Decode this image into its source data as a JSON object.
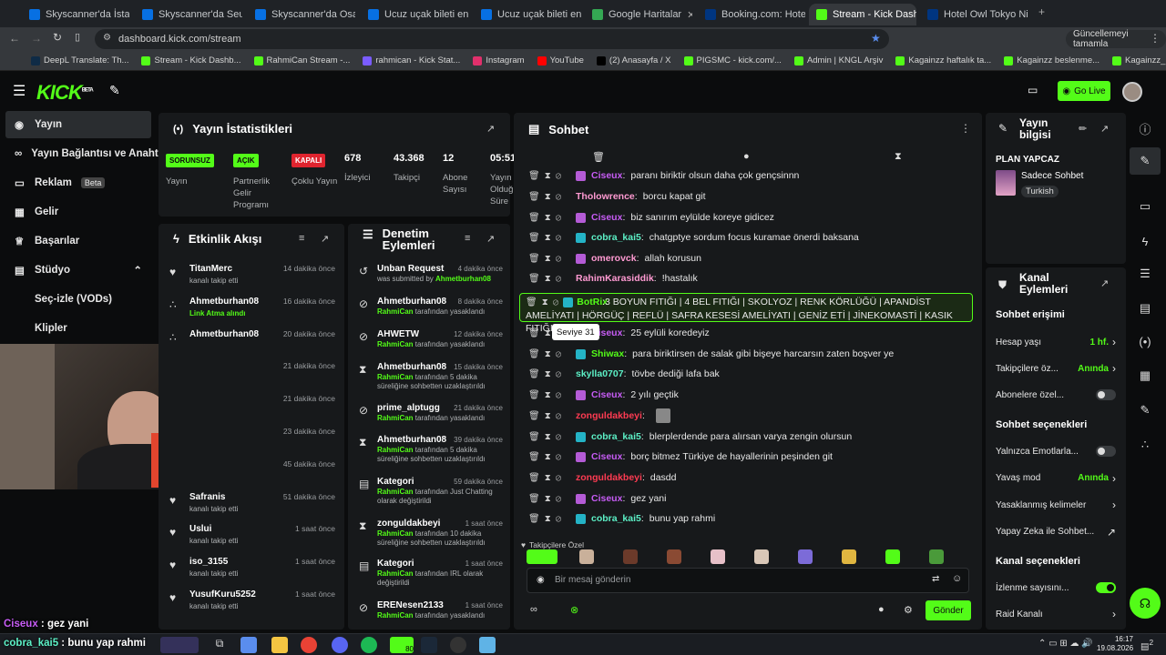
{
  "tabs": [
    {
      "label": "Skyscanner'da İstanb",
      "color": "#0770e3"
    },
    {
      "label": "Skyscanner'da Seul-T",
      "color": "#0770e3"
    },
    {
      "label": "Skyscanner'da Osaka",
      "color": "#0770e3"
    },
    {
      "label": "Ucuz uçak bileti en u",
      "color": "#0770e3"
    },
    {
      "label": "Ucuz uçak bileti en u",
      "color": "#0770e3"
    },
    {
      "label": "Google Haritalar",
      "color": "#34a853"
    },
    {
      "label": "Booking.com: Hotels",
      "color": "#003580"
    },
    {
      "label": "Stream - Kick Dashb",
      "color": "#53fc18"
    },
    {
      "label": "Hotel Owl Tokyo Nip",
      "color": "#003580"
    }
  ],
  "browser": {
    "url": "dashboard.kick.com/stream",
    "update_label": "Güncellemeyi tamamla"
  },
  "bookmarks": [
    "DeepL Translate: Th...",
    "Stream - Kick Dashb...",
    "RahmiCan Stream -...",
    "rahmican - Kick Stat...",
    "Instagram",
    "YouTube",
    "(2) Anasayfa / X",
    "PIGSMC - kick.com/...",
    "Admin | KNGL Arşiv",
    "Kagainzz haftalık ta...",
    "Kagainzz beslenme...",
    "Kagainzz_PPLXUL -..."
  ],
  "header": {
    "logo": "KICK",
    "logo_sup": "BETA",
    "go_live": "Go Live"
  },
  "sidebar": [
    {
      "label": "Yayın",
      "icon": "play-icon"
    },
    {
      "label": "Yayın Bağlantısı ve Anahtarı",
      "icon": "link-icon"
    },
    {
      "label": "Reklam",
      "badge": "Beta",
      "icon": "ad-icon"
    },
    {
      "label": "Gelir",
      "icon": "revenue-icon"
    },
    {
      "label": "Başarılar",
      "icon": "trophy-icon"
    },
    {
      "label": "Stüdyo",
      "icon": "studio-icon"
    },
    {
      "label": "Seç-izle (VODs)",
      "icon": ""
    },
    {
      "label": "Klipler",
      "icon": ""
    }
  ],
  "stats": {
    "title": "Yayın İstatistikleri",
    "items": [
      {
        "pill": "SORUNSUZ",
        "pill_color": "#53fc18",
        "label": "Yayın"
      },
      {
        "pill": "AÇIK",
        "pill_color": "#53fc18",
        "label": "Partnerlik Gelir Programı"
      },
      {
        "pill": "KAPALI",
        "pill_color": "#e0242f",
        "label": "Çoklu Yayın"
      },
      {
        "value": "678",
        "label": "İzleyici"
      },
      {
        "value": "43.368",
        "label": "Takipçi"
      },
      {
        "value": "12",
        "label": "Abone Sayısı"
      },
      {
        "value": "05:51",
        "label": "Yayın Olduğu Süre"
      }
    ]
  },
  "activity": {
    "title": "Etkinlik Akışı",
    "items": [
      {
        "name": "TitanMerc",
        "sub": "kanalı takip etti",
        "time": "14 dakika önce",
        "icon": "heart-icon"
      },
      {
        "name": "Ahmetburhan08",
        "sub": "Link Atma alındı",
        "time": "16 dakika önce",
        "icon": "points-icon"
      },
      {
        "name": "Ahmetburhan08",
        "sub": "",
        "time": "20 dakika önce",
        "icon": "points-icon"
      },
      {
        "name": "",
        "sub": "",
        "time": "21 dakika önce",
        "icon": ""
      },
      {
        "name": "",
        "sub": "",
        "time": "21 dakika önce",
        "icon": ""
      },
      {
        "name": "",
        "sub": "",
        "time": "23 dakika önce",
        "icon": ""
      },
      {
        "name": "",
        "sub": "",
        "time": "45 dakika önce",
        "icon": ""
      },
      {
        "name": "Safranis",
        "sub": "kanalı takip etti",
        "time": "51 dakika önce",
        "icon": "heart-icon"
      },
      {
        "name": "Uslui",
        "sub": "kanalı takip etti",
        "time": "1 saat önce",
        "icon": "heart-icon"
      },
      {
        "name": "iso_3155",
        "sub": "kanalı takip etti",
        "time": "1 saat önce",
        "icon": "heart-icon"
      },
      {
        "name": "YusufKuru5252",
        "sub": "kanalı takip etti",
        "time": "1 saat önce",
        "icon": "heart-icon"
      }
    ]
  },
  "moderation": {
    "title": "Denetim Eylemleri",
    "items": [
      {
        "name": "Unban Request",
        "sub_pre": "was submitted by ",
        "sub_hl": "Ahmetburhan08",
        "sub_post": "",
        "time": "4 dakika önce",
        "icon": "history-icon"
      },
      {
        "name": "Ahmetburhan08",
        "sub_pre": "",
        "sub_hl": "RahmiCan",
        "sub_post": " tarafından yasaklandı",
        "time": "8 dakika önce",
        "icon": "ban-icon"
      },
      {
        "name": "AHWETW",
        "sub_pre": "",
        "sub_hl": "RahmiCan",
        "sub_post": " tarafından yasaklandı",
        "time": "12 dakika önce",
        "icon": "ban-icon"
      },
      {
        "name": "Ahmetburhan08",
        "sub_pre": "",
        "sub_hl": "RahmiCan",
        "sub_post": " tarafından 5 dakika süreliğine sohbetten uzaklaştırıldı",
        "time": "15 dakika önce",
        "icon": "timeout-icon"
      },
      {
        "name": "prime_alptugg",
        "sub_pre": "",
        "sub_hl": "RahmiCan",
        "sub_post": " tarafından yasaklandı",
        "time": "21 dakika önce",
        "icon": "ban-icon"
      },
      {
        "name": "Ahmetburhan08",
        "sub_pre": "",
        "sub_hl": "RahmiCan",
        "sub_post": " tarafından 5 dakika süreliğine sohbetten uzaklaştırıldı",
        "time": "39 dakika önce",
        "icon": "timeout-icon"
      },
      {
        "name": "Kategori",
        "sub_pre": "",
        "sub_hl": "RahmiCan",
        "sub_post": " tarafından Just Chatting olarak değiştirildi",
        "time": "59 dakika önce",
        "icon": "category-icon"
      },
      {
        "name": "zonguldakbeyi",
        "sub_pre": "",
        "sub_hl": "RahmiCan",
        "sub_post": " tarafından 10 dakika süreliğine sohbetten uzaklaştırıldı",
        "time": "1 saat önce",
        "icon": "timeout-icon"
      },
      {
        "name": "Kategori",
        "sub_pre": "",
        "sub_hl": "RahmiCan",
        "sub_post": " tarafından IRL olarak değiştirildi",
        "time": "1 saat önce",
        "icon": "category-icon"
      },
      {
        "name": "ERENesen2133",
        "sub_pre": "",
        "sub_hl": "RahmiCan",
        "sub_post": " tarafından yasaklandı",
        "time": "1 saat önce",
        "icon": "ban-icon"
      }
    ]
  },
  "chat": {
    "title": "Sohbet",
    "tooltip": "Seviye 31",
    "followers_only": "Takipçilere Özel",
    "placeholder": "Bir mesaj gönderin",
    "send": "Gönder",
    "messages": [
      {
        "user": "Ciseux",
        "color": "#c75cf5",
        "text": "paranı biriktir olsun daha çok gençsinnn",
        "badge": "#b45bd6"
      },
      {
        "user": "Tholowrence",
        "color": "#ff9ad2",
        "text": "borcu kapat git",
        "badge": ""
      },
      {
        "user": "Ciseux",
        "color": "#c75cf5",
        "text": "biz sanırım eylülde koreye gidicez",
        "badge": "#b45bd6"
      },
      {
        "user": "cobra_kai5",
        "color": "#5cf0c6",
        "text": "chatgptye sordum focus kuramae önerdi baksana",
        "badge": "#24b3c6"
      },
      {
        "user": "omerovck",
        "color": "#ff9ad2",
        "text": "allah korusun",
        "badge": "#b45bd6"
      },
      {
        "user": "RahimKarasiddik",
        "color": "#ff9ad2",
        "text": "!hastalık",
        "badge": ""
      },
      {
        "user": "BotRix",
        "color": "#53fc18",
        "text": "3 BOYUN FITIĞI | 4 BEL FITIĞI | SKOLYOZ | RENK KÖRLÜĞÜ | APANDİST AMELİYATI | HÖRGÜÇ | REFLÜ | SAFRA KESESİ AMELİYATI | GENİZ ETİ | JİNEKOMASTİ | KASIK FITIĞI",
        "badge": "#24b3c6"
      },
      {
        "user": "Ciseux",
        "color": "#c75cf5",
        "text": "25 eylüli koredeyiz",
        "badge": "#b45bd6"
      },
      {
        "user": "Shiwax",
        "color": "#53fc18",
        "text": "para biriktirsen de salak gibi bişeye harcarsın zaten boşver ye",
        "badge": "#24b3c6"
      },
      {
        "user": "skylla0707",
        "color": "#5cf0c6",
        "text": "tövbe dediği lafa bak",
        "badge": ""
      },
      {
        "user": "Ciseux",
        "color": "#c75cf5",
        "text": "2 yılı geçtik",
        "badge": "#b45bd6"
      },
      {
        "user": "zonguldakbeyi",
        "color": "#ff3b52",
        "text": "",
        "badge": ""
      },
      {
        "user": "cobra_kai5",
        "color": "#5cf0c6",
        "text": "blerplerdende para alırsan varya zengin olursun",
        "badge": "#24b3c6"
      },
      {
        "user": "Ciseux",
        "color": "#c75cf5",
        "text": "borç bitmez Türkiye de hayallerinin peşinden git",
        "badge": "#b45bd6"
      },
      {
        "user": "zonguldakbeyi",
        "color": "#ff3b52",
        "text": "dasdd",
        "badge": ""
      },
      {
        "user": "Ciseux",
        "color": "#c75cf5",
        "text": "gez yani",
        "badge": "#b45bd6"
      },
      {
        "user": "cobra_kai5",
        "color": "#5cf0c6",
        "text": "bunu yap rahmi",
        "badge": "#24b3c6"
      }
    ]
  },
  "info": {
    "title": "Yayın bilgisi",
    "stream_title": "PLAN YAPCAZ",
    "category": "Sadece Sohbet",
    "language": "Turkish"
  },
  "channel": {
    "title": "Kanal Eylemleri",
    "access_header": "Sohbet erişimi",
    "access": [
      {
        "label": "Hesap yaşı",
        "value": "1 hf.",
        "type": "link"
      },
      {
        "label": "Takipçilere öz...",
        "value": "Anında",
        "type": "link"
      },
      {
        "label": "Abonelere özel...",
        "value": "",
        "type": "toggle",
        "on": false
      }
    ],
    "options_header": "Sohbet seçenekleri",
    "options": [
      {
        "label": "Yalnızca Emotlarla...",
        "value": "",
        "type": "toggle",
        "on": false
      },
      {
        "label": "Yavaş mod",
        "value": "Anında",
        "type": "link"
      },
      {
        "label": "Yasaklanmış kelimeler",
        "value": "",
        "type": "link"
      },
      {
        "label": "Yapay Zeka ile Sohbet...",
        "value": "",
        "type": "external"
      }
    ],
    "channel_header": "Kanal seçenekleri",
    "channel_opts": [
      {
        "label": "İzlenme sayısını...",
        "value": "",
        "type": "toggle",
        "on": true
      },
      {
        "label": "Raid Kanalı",
        "value": "",
        "type": "link"
      }
    ]
  },
  "overlay": {
    "line1_user": "Ciseux",
    "line1_text": "gez yani",
    "line2_user": "cobra_kai5",
    "line2_text": "bunu yap rahmi"
  },
  "taskbar": {
    "time": "16:17",
    "date": "19.08.2026",
    "badge": "80",
    "notif": "2"
  }
}
